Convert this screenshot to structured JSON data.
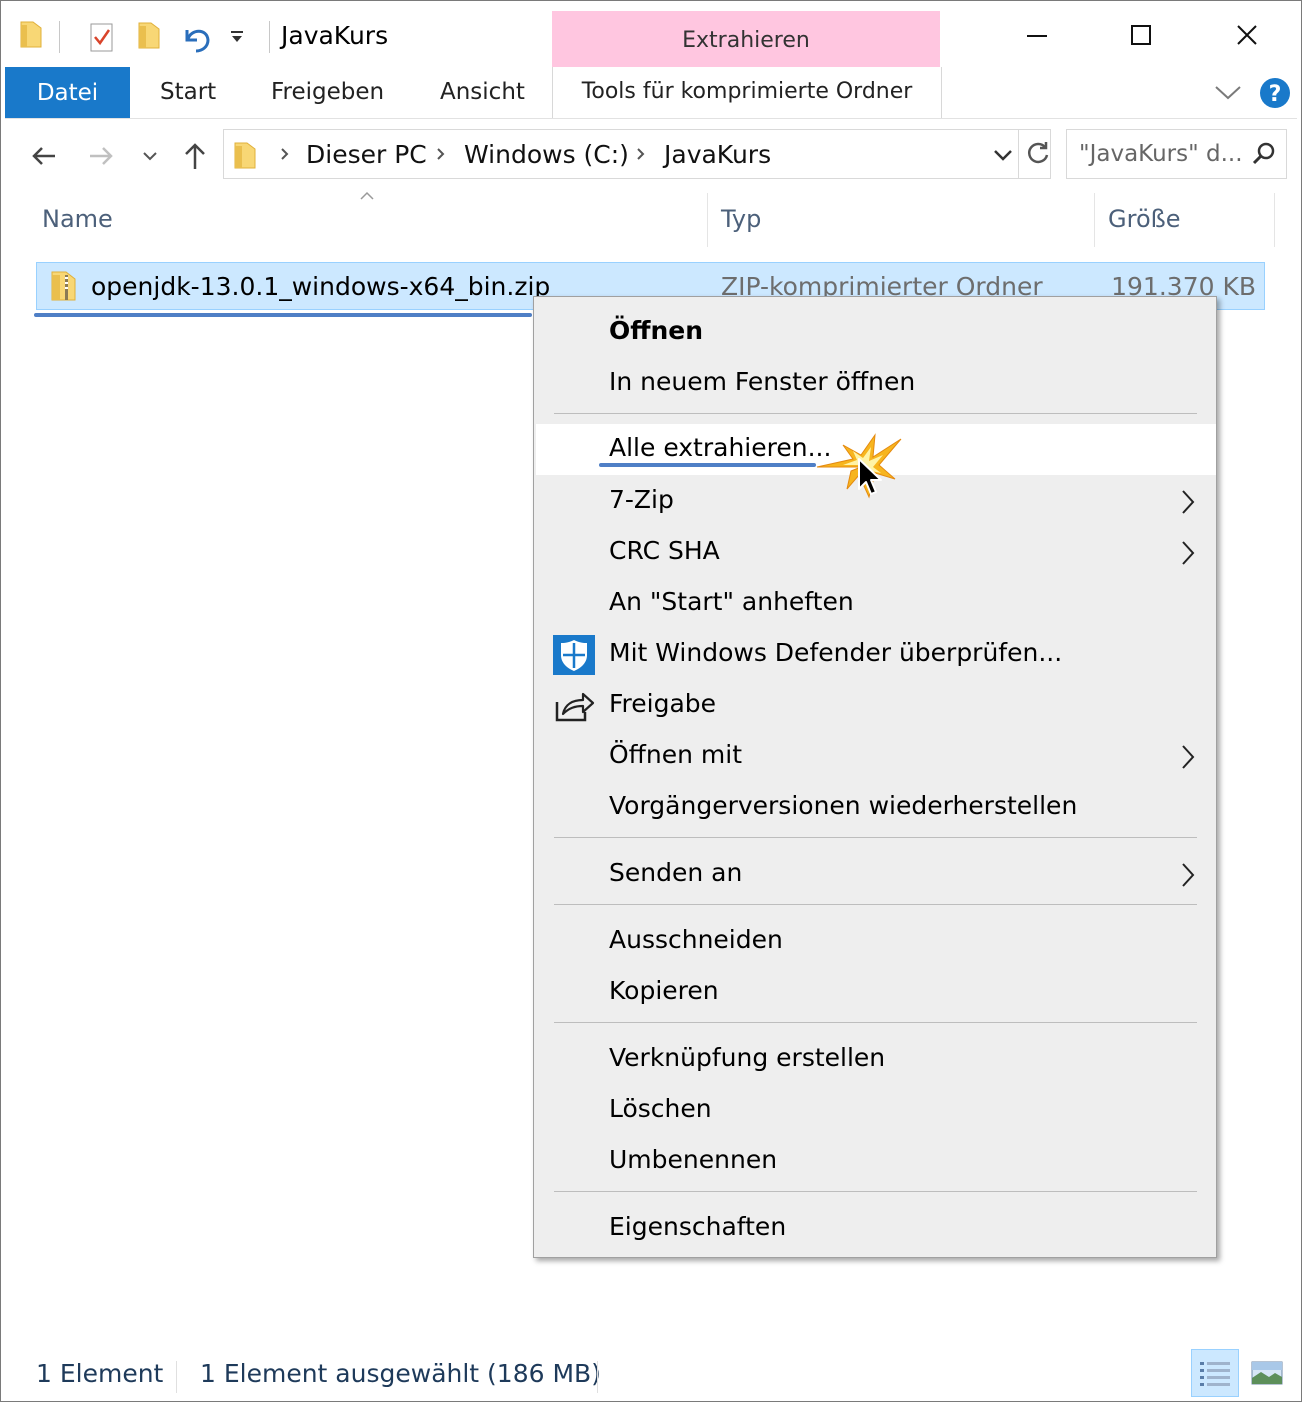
{
  "window": {
    "title": "JavaKurs",
    "contextual_tab_group": "Extrahieren"
  },
  "ribbon": {
    "tabs": [
      "Datei",
      "Start",
      "Freigeben",
      "Ansicht"
    ],
    "contextual_tab": "Tools für komprimierte Ordner"
  },
  "navigation": {
    "breadcrumbs": [
      "Dieser PC",
      "Windows (C:)",
      "JavaKurs"
    ],
    "search_placeholder": "\"JavaKurs\" d..."
  },
  "columns": {
    "name": "Name",
    "type": "Typ",
    "size": "Größe"
  },
  "files": [
    {
      "name": "openjdk-13.0.1_windows-x64_bin.zip",
      "type": "ZIP-komprimierter Ordner",
      "size": "191.370 KB",
      "selected": true
    }
  ],
  "context_menu": {
    "items": [
      {
        "label": "Öffnen",
        "bold": true
      },
      {
        "label": "In neuem Fenster öffnen"
      },
      {
        "label": "Alle extrahieren...",
        "hovered": true
      },
      {
        "label": "7-Zip",
        "submenu": true
      },
      {
        "label": "CRC SHA",
        "submenu": true
      },
      {
        "label": "An \"Start\" anheften"
      },
      {
        "label": "Mit Windows Defender überprüfen...",
        "icon": "windows-defender-shield-icon"
      },
      {
        "label": "Freigabe",
        "icon": "share-icon"
      },
      {
        "label": "Öffnen mit",
        "submenu": true
      },
      {
        "label": "Vorgängerversionen wiederherstellen"
      },
      {
        "label": "Senden an",
        "submenu": true
      },
      {
        "label": "Ausschneiden"
      },
      {
        "label": "Kopieren"
      },
      {
        "label": "Verknüpfung erstellen"
      },
      {
        "label": "Löschen"
      },
      {
        "label": "Umbenennen"
      },
      {
        "label": "Eigenschaften"
      }
    ]
  },
  "status_bar": {
    "item_count": "1 Element",
    "selection": "1 Element ausgewählt (186 MB)"
  },
  "colors": {
    "accent": "#1979ca",
    "contextual_tab": "#ffc6e0",
    "selection_bg": "#cce8ff",
    "selection_border": "#99d1ff",
    "menu_bg": "#eeeeee",
    "highlight_underline": "#4f7fc6"
  }
}
